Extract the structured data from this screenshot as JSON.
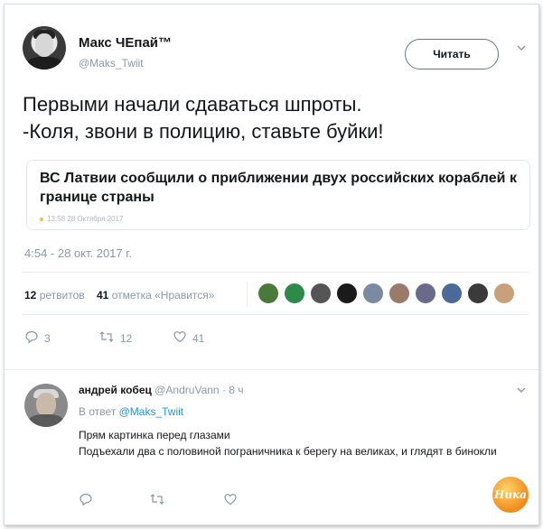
{
  "tweet": {
    "author_name": "Макс ЧЕпай™",
    "author_handle": "@Maks_Twiit",
    "follow_label": "Читать",
    "text_line1": "Первыми начали сдаваться шпроты.",
    "text_line2": "-Коля, звони в полицию, ставьте буйки!",
    "card": {
      "title": "ВС Латвии сообщили о приближении двух российских кораблей к границе страны",
      "meta": "13:58  28 Октября 2017"
    },
    "timestamp": "4:54 - 28 окт. 2017 г.",
    "retweets_count": "12",
    "retweets_label": "ретвитов",
    "likes_count": "41",
    "likes_label": "отметка «Нравится»",
    "actions": {
      "reply_count": "3",
      "retweet_count": "12",
      "like_count": "41"
    }
  },
  "liker_colors": [
    "#4a7a3a",
    "#2e8a4a",
    "#555555",
    "#1a1a1a",
    "#7a8aa0",
    "#9a7a6a",
    "#6a6a8a",
    "#4a6a9a",
    "#3a3a3a",
    "#c8a07a"
  ],
  "reply": {
    "author_name": "андрей кобец",
    "author_handle": "@AndruVann",
    "time": "· 8 ч",
    "reply_to_prefix": "В ответ",
    "reply_to_handle": "@Maks_Twiit",
    "text_line1": "Прям картинка перед глазами",
    "text_line2": "Подъехали два с половиной пограничника к берегу на великах, и глядят в бинокли"
  },
  "watermark": "Ника",
  "colors": {
    "link": "#1b95e0",
    "muted": "#8899a6"
  }
}
